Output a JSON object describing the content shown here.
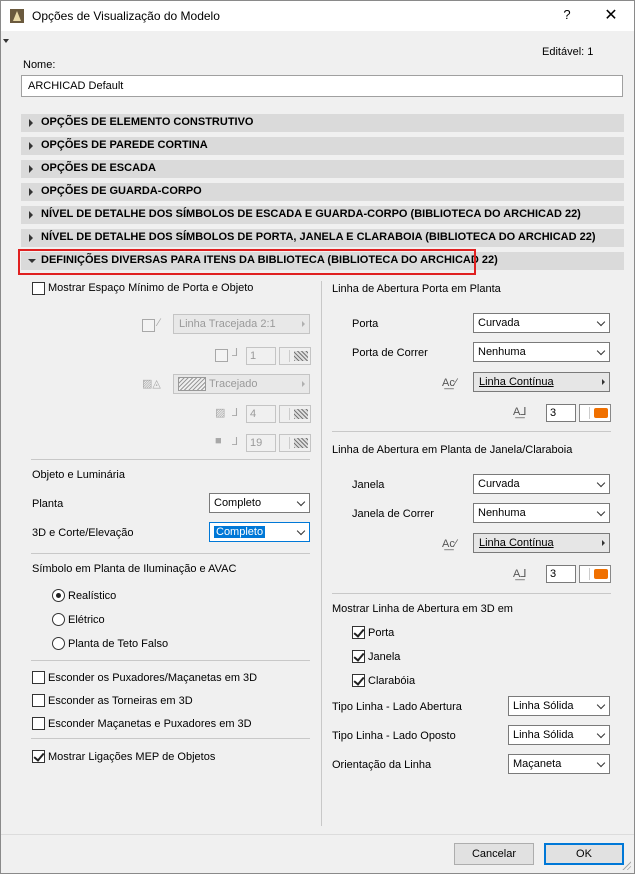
{
  "window": {
    "title": "Opções de Visualização do Modelo",
    "help": "?",
    "close": "✕"
  },
  "header": {
    "editable_label": "Editável: 1",
    "name_label": "Nome:",
    "name_value": "ARCHICAD Default"
  },
  "sections": [
    "OPÇÕES DE ELEMENTO CONSTRUTIVO",
    "OPÇÕES DE PAREDE CORTINA",
    "OPÇÕES DE ESCADA",
    "OPÇÕES DE GUARDA-CORPO",
    "NÍVEL DE DETALHE DOS SÍMBOLOS DE ESCADA E GUARDA-CORPO (BIBLIOTECA DO ARCHICAD 22)",
    "NÍVEL DE DETALHE DOS SÍMBOLOS DE PORTA, JANELA E CLARABOIA (BIBLIOTECA DO ARCHICAD 22)",
    "DEFINIÇÕES DIVERSAS PARA ITENS DA BIBLIOTECA (BIBLIOTECA DO ARCHICAD 22)"
  ],
  "left": {
    "min_space": {
      "label": "Mostrar Espaço Mínimo de Porta e Objeto",
      "checked": false
    },
    "line_type": "Linha Tracejada 2:1",
    "pen1": "1",
    "fill_type": "Tracejado",
    "pen2": "4",
    "pen3": "19",
    "object_group": {
      "title": "Objeto e Luminária",
      "plan_label": "Planta",
      "plan_value": "Completo",
      "section_label": "3D e Corte/Elevação",
      "section_value": "Completo"
    },
    "symbol_group": {
      "title": "Símbolo em Planta de Iluminação e AVAC",
      "options": [
        "Realístico",
        "Elétrico",
        "Planta de Teto Falso"
      ],
      "selected": "Realístico"
    },
    "hide": [
      {
        "label": "Esconder os Puxadores/Maçanetas em 3D",
        "checked": false
      },
      {
        "label": "Esconder as Torneiras em 3D",
        "checked": false
      },
      {
        "label": "Esconder Maçanetas e Puxadores em 3D",
        "checked": false
      }
    ],
    "mep": {
      "label": "Mostrar Ligações MEP de Objetos",
      "checked": true
    }
  },
  "right": {
    "door_group": {
      "title": "Linha de Abertura Porta em Planta",
      "door_label": "Porta",
      "door_value": "Curvada",
      "sliding_label": "Porta de Correr",
      "sliding_value": "Nenhuma",
      "line_type": "Linha Contínua",
      "pen": "3"
    },
    "window_group": {
      "title": "Linha de Abertura em Planta de Janela/Claraboia",
      "window_label": "Janela",
      "window_value": "Curvada",
      "sliding_label": "Janela de Correr",
      "sliding_value": "Nenhuma",
      "line_type": "Linha Contínua",
      "pen": "3"
    },
    "show3d_group": {
      "title": "Mostrar Linha de Abertura em 3D em",
      "items": [
        {
          "label": "Porta",
          "checked": true
        },
        {
          "label": "Janela",
          "checked": true
        },
        {
          "label": "Clarabóia",
          "checked": true
        }
      ],
      "open_side_label": "Tipo Linha - Lado Abertura",
      "open_side_value": "Linha Sólida",
      "opposite_label": "Tipo Linha - Lado Oposto",
      "opposite_value": "Linha Sólida",
      "orientation_label": "Orientação da Linha",
      "orientation_value": "Maçaneta"
    }
  },
  "footer": {
    "cancel": "Cancelar",
    "ok": "OK"
  },
  "colors": {
    "highlight": "#e02020",
    "pen_orange": "#f07000",
    "accent": "#0078d7"
  }
}
